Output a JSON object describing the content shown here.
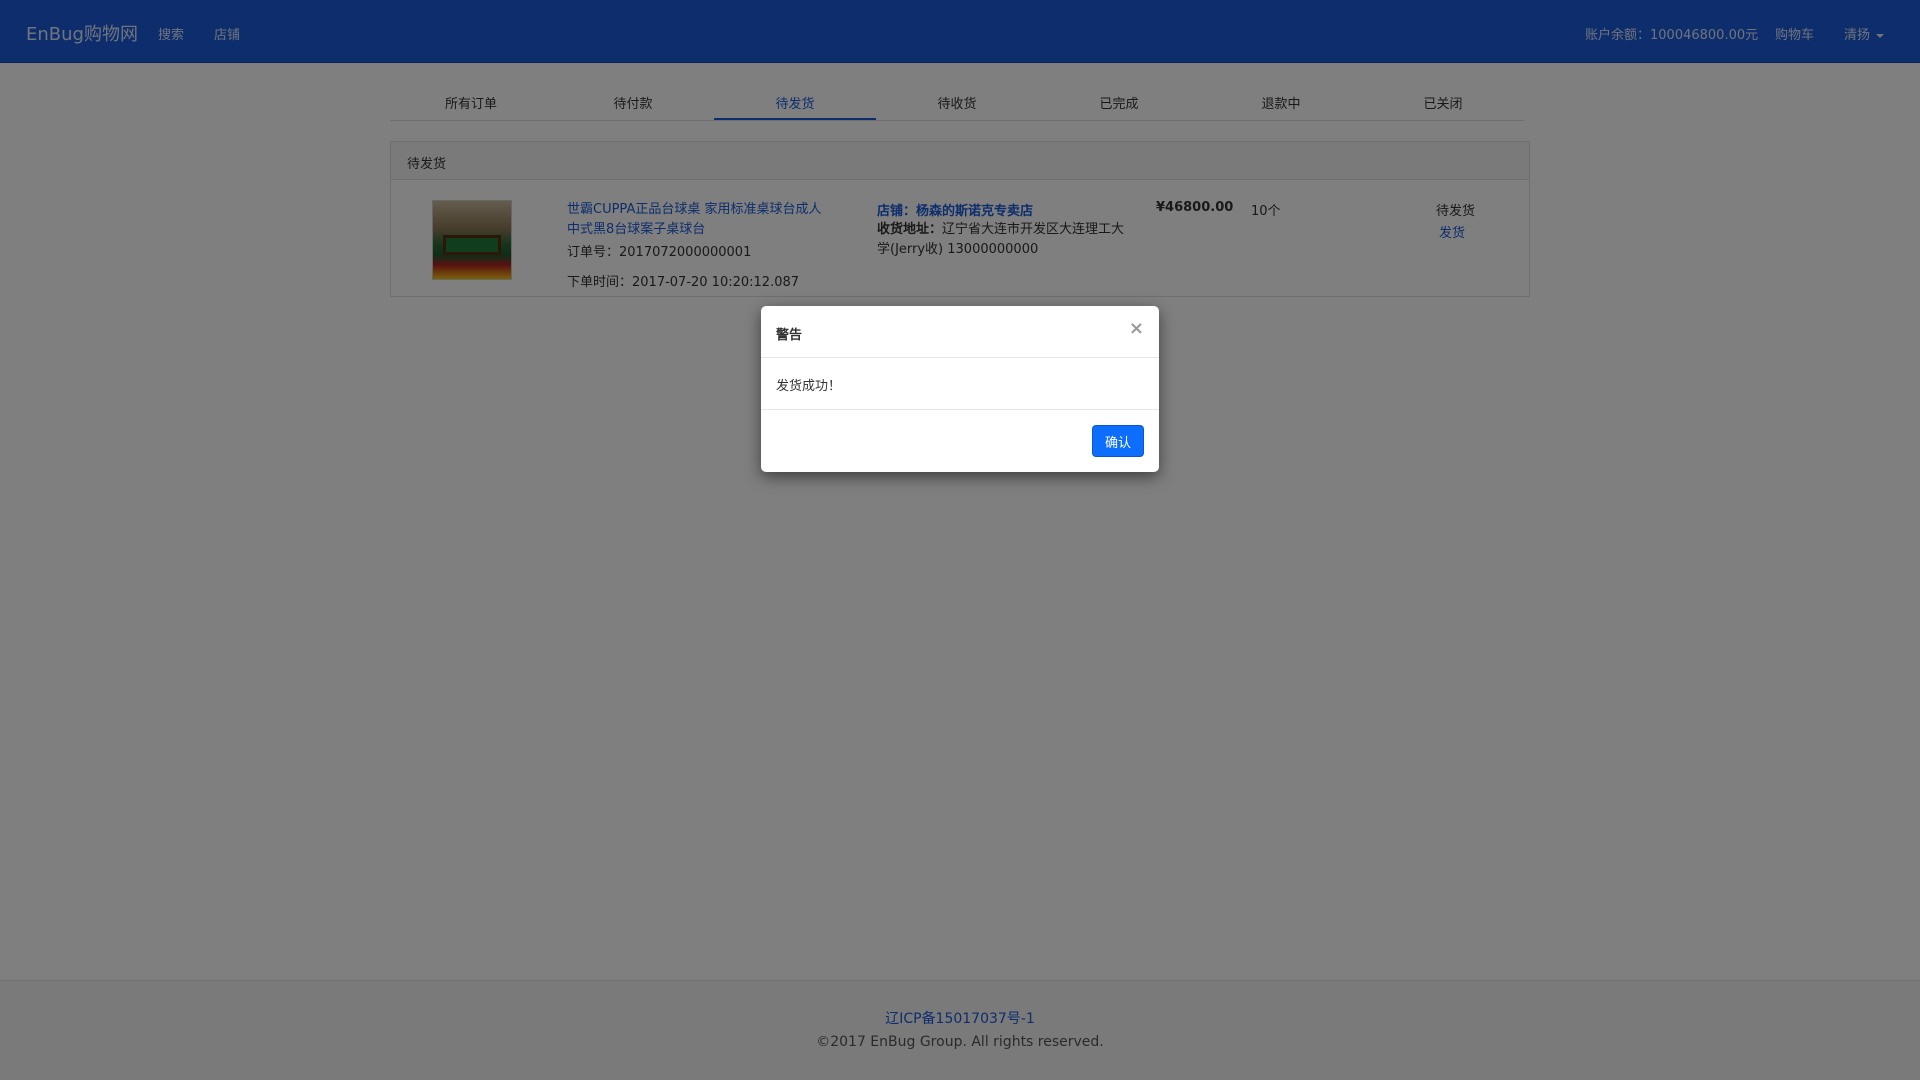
{
  "navbar": {
    "brand": "EnBug购物网",
    "links": [
      "搜索",
      "店铺"
    ],
    "balance": "账户余额：100046800.00元",
    "cart": "购物车",
    "user": "清扬"
  },
  "tabs": [
    {
      "label": "所有订单",
      "active": false
    },
    {
      "label": "待付款",
      "active": false
    },
    {
      "label": "待发货",
      "active": true
    },
    {
      "label": "待收货",
      "active": false
    },
    {
      "label": "已完成",
      "active": false
    },
    {
      "label": "退款中",
      "active": false
    },
    {
      "label": "已关闭",
      "active": false
    }
  ],
  "panel": {
    "heading": "待发货",
    "order": {
      "product_title": "世霸CUPPA正品台球桌 家用标准桌球台成人中式黑8台球案子桌球台",
      "order_no": "订单号：2017072000000001",
      "order_time": "下单时间：2017-07-20 10:20:12.087",
      "store": "店铺：杨森的斯诺克专卖店",
      "address_label": "收货地址：",
      "address": "辽宁省大连市开发区大连理工大学(Jerry收) 13000000000",
      "price": "¥46800.00",
      "quantity": "10个",
      "status": "待发货",
      "action": "发货"
    }
  },
  "footer": {
    "icp": "辽ICP备15017037号-1",
    "copyright": "©2017 EnBug Group. All rights reserved."
  },
  "modal": {
    "title": "警告",
    "close": "×",
    "message": "发货成功！",
    "confirm": "确认"
  }
}
